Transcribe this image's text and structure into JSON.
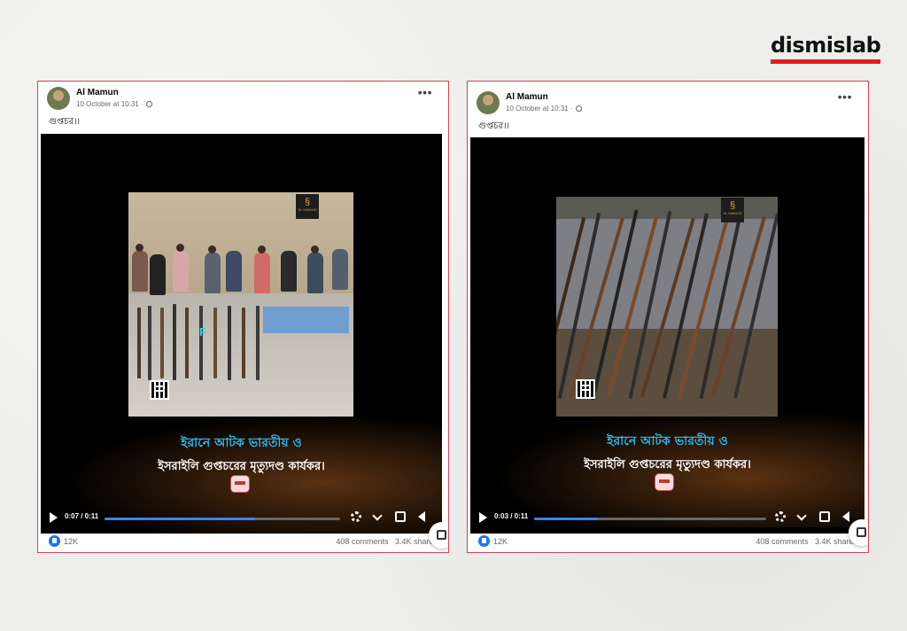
{
  "brand": {
    "name": "dismislab",
    "accent_color": "#e31b23"
  },
  "posts": [
    {
      "author": "Al Mamun",
      "timestamp": "10 October at 10:31 ·",
      "caption": "গুপ্তচর।।",
      "video": {
        "scene": "men-lined-up-with-weapons",
        "badge_text": "AL MAMUN",
        "watermark_letter": "F",
        "headline_line1": "ইরানে আটক ভারতীয় ও",
        "headline_line2": "ইসরাইলি গুপ্তচরের মৃত্যুদণ্ড কার্যকর।",
        "time": "0:07 / 0:11",
        "progress": 0.64
      },
      "likes": "12K",
      "comments": "408 comments",
      "shares": "3.4K shares"
    },
    {
      "author": "Al Mamun",
      "timestamp": "10 October at 10:31 ·",
      "caption": "গুপ্তচর।।",
      "video": {
        "scene": "stacked-rifles",
        "badge_text": "AL MAMUN",
        "headline_line1": "ইরানে আটক ভারতীয় ও",
        "headline_line2": "ইসরাইলি গুপ্তচরের মৃত্যুদণ্ড কার্যকর।",
        "time": "0:03 / 0:11",
        "progress": 0.27
      },
      "likes": "12K",
      "comments": "408 comments",
      "shares": "3.4K shares"
    }
  ]
}
